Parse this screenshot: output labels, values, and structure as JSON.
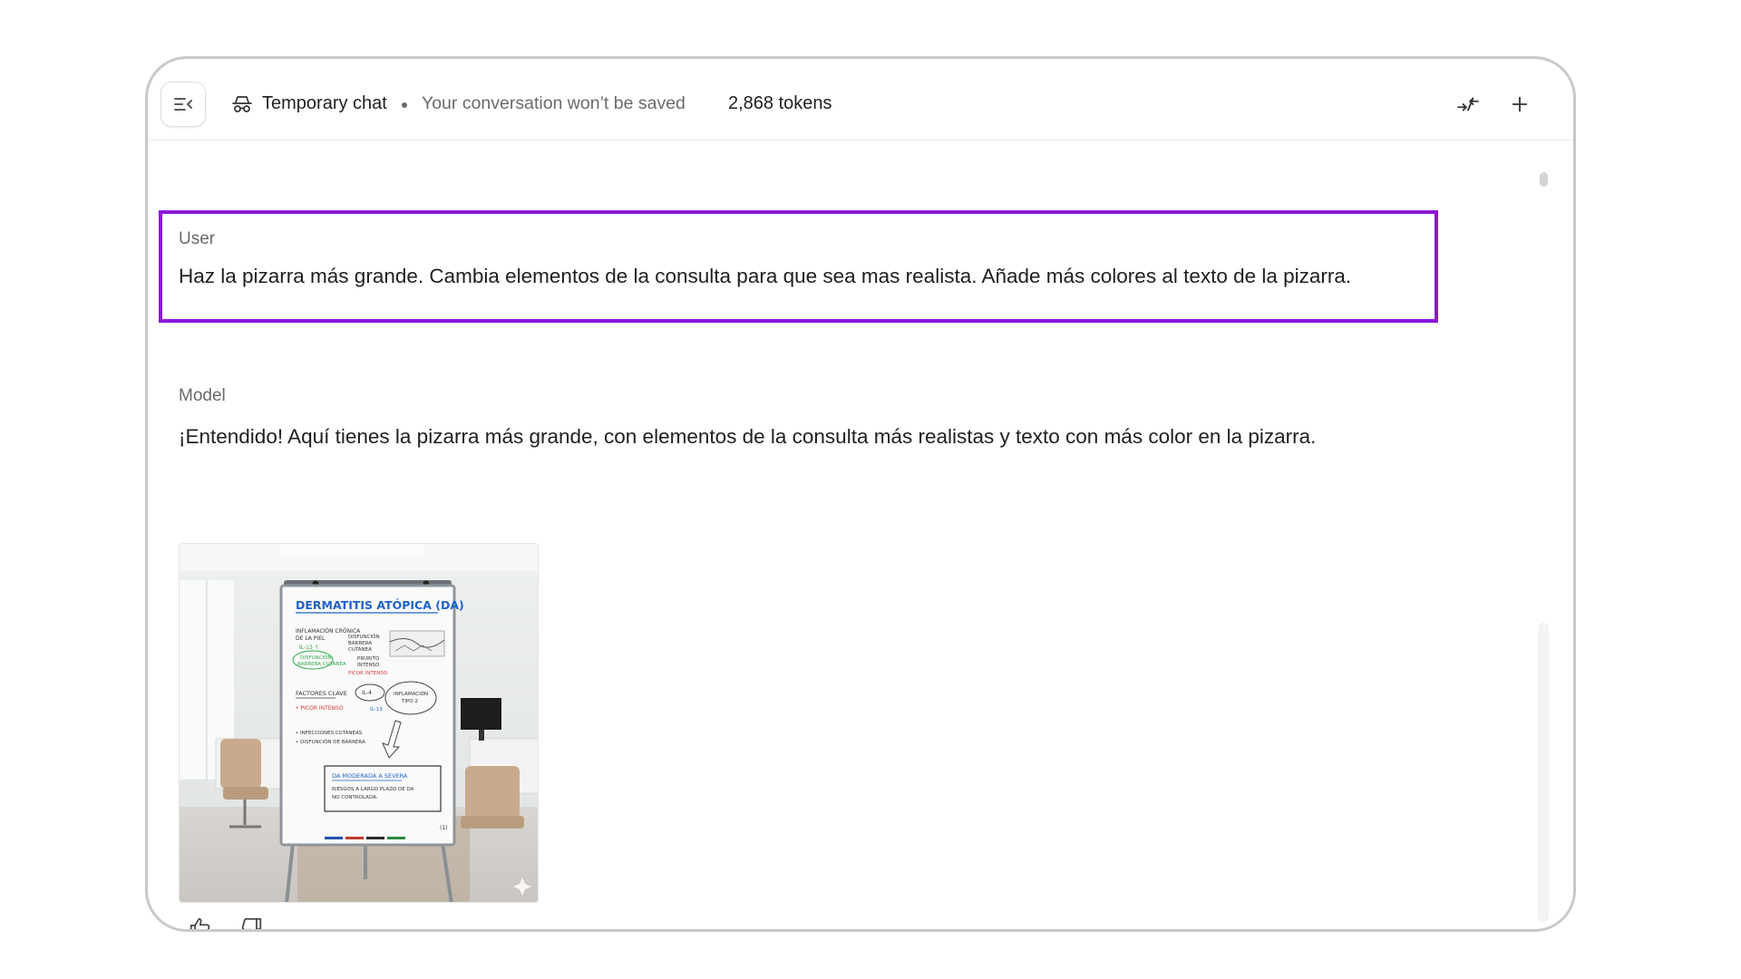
{
  "header": {
    "menu_icon": "sidebar-toggle-icon",
    "temp_icon": "incognito-icon",
    "title": "Temporary chat",
    "subtitle": "Your conversation won’t be saved",
    "tokens": "2,868 tokens",
    "compare_icon": "compare-arrows-icon",
    "new_chat_icon": "plus-icon"
  },
  "messages": [
    {
      "role": "User",
      "text": "Haz la pizarra más grande. Cambia elementos de la consulta para que sea mas realista. Añade más colores al texto de la pizarra."
    },
    {
      "role": "Model",
      "text": "¡Entendido! Aquí tienes la pizarra más grande, con elementos de la consulta más realistas y texto con más color en la pizarra."
    }
  ],
  "image": {
    "board_title": "DERMATITIS ATÓPICA (DA)",
    "left_notes": [
      "INFLAMACIÓN CRÓNICA",
      "DE LA PIEL",
      "IL-13 ↑",
      "DISFUNCIÓN",
      "BARRERA CUTÁNEA"
    ],
    "right_notes": [
      "DISFUNCIÓN",
      "BARRERA",
      "CUTÁNEA",
      "PRURITO",
      "INTENSO",
      "PICOR INTENSO"
    ],
    "factors_title": "FACTORES CLAVE",
    "factor_red": "• PICOR INTENSO",
    "bubble_1": "IL-4",
    "bubble_2a": "INFLAMACIÓN",
    "bubble_2b": "TIPO 2",
    "bullets": [
      "• INFECCIONES CUTÁNEAS",
      "• DISFUNCIÓN DE BARRERA"
    ],
    "il13": "IL-13",
    "box_title": "DA MODERADA A SEVERA",
    "box_line1": "RIESGOS A LARGO PLAZO DE DA",
    "box_line2": "NO CONTROLADA.",
    "page_num": "(1)"
  },
  "feedback": {
    "like_icon": "thumbs-up-icon",
    "dislike_icon": "thumbs-down-icon"
  },
  "colors": {
    "highlight": "#8a16d9",
    "board_blue": "#1e63c9",
    "board_green": "#2ea84a",
    "board_red": "#d63a3a"
  }
}
